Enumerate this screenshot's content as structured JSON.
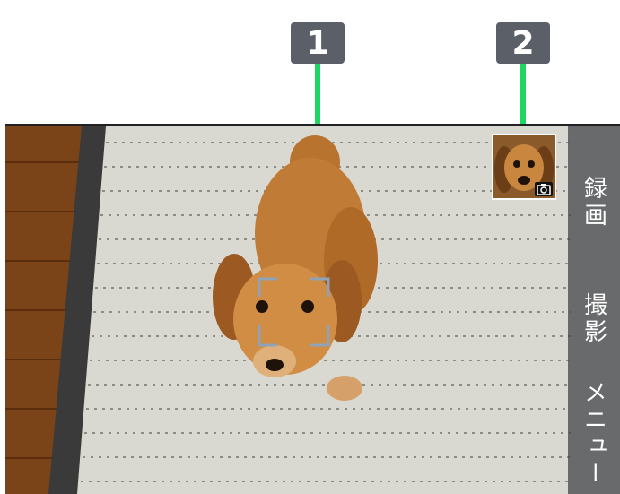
{
  "callouts": [
    {
      "label": "1"
    },
    {
      "label": "2"
    }
  ],
  "side_buttons": {
    "record": "録画",
    "shutter": "撮影",
    "menu": "メニュー"
  },
  "icons": {
    "thumbnail": "last-photo-thumbnail",
    "camera": "camera-icon",
    "focus": "face-detection-frame"
  },
  "colors": {
    "callout_line": "#1ed760",
    "callout_badge": "#5b6068",
    "side_panel": "#3c3e42"
  }
}
